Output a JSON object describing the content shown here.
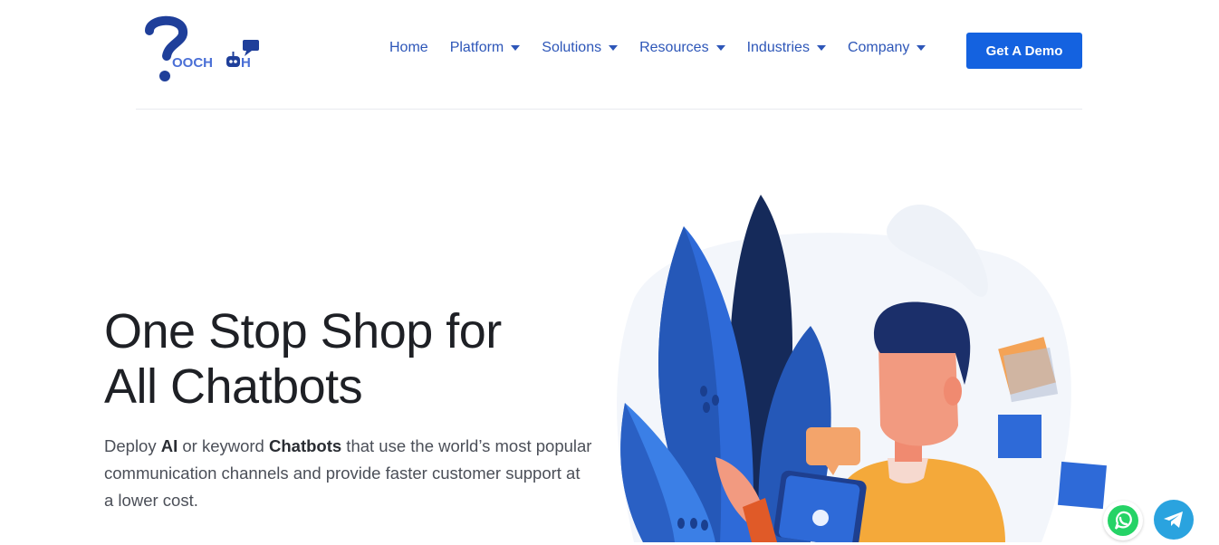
{
  "brand": {
    "logo_text": "OOCH",
    "logo_text_end": "H",
    "accent": "#1462e0",
    "logo_color": "#1f3f9a"
  },
  "nav": {
    "items": [
      {
        "label": "Home",
        "has_dropdown": false
      },
      {
        "label": "Platform",
        "has_dropdown": true
      },
      {
        "label": "Solutions",
        "has_dropdown": true
      },
      {
        "label": "Resources",
        "has_dropdown": true
      },
      {
        "label": "Industries",
        "has_dropdown": true
      },
      {
        "label": "Company",
        "has_dropdown": true
      }
    ],
    "cta_label": "Get A Demo"
  },
  "hero": {
    "title_line1": "One Stop Shop for",
    "title_line2": "All Chatbots",
    "desc_pre": "Deploy ",
    "desc_b1": "AI",
    "desc_mid": " or keyword ",
    "desc_b2": "Chatbots",
    "desc_post": " that use the world’s most popular communication channels and provide faster customer support at a lower cost."
  },
  "floating": {
    "whatsapp_icon": "whatsapp-icon",
    "telegram_icon": "telegram-icon"
  }
}
